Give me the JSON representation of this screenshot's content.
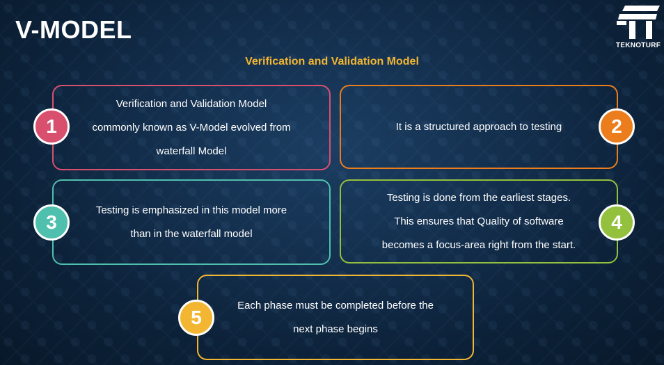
{
  "header": {
    "title": "V-MODEL",
    "subtitle": "Verification and Validation Model"
  },
  "logo": {
    "text": "TEKNOTURF"
  },
  "cards": [
    {
      "number": "1",
      "text": "Verification and Validation Model\ncommonly known as V-Model evolved from\nwaterfall Model",
      "color": "#d9506f"
    },
    {
      "number": "2",
      "text": "It is a structured approach to testing",
      "color": "#ec7d1c"
    },
    {
      "number": "3",
      "text": "Testing is emphasized in this model more\nthan in the waterfall model",
      "color": "#4fbfae"
    },
    {
      "number": "4",
      "text": "Testing is done from the earliest stages.\nThis ensures that Quality of software\nbecomes a focus-area right from the start.",
      "color": "#93c13e"
    },
    {
      "number": "5",
      "text": "Each phase must be completed before the\nnext phase begins",
      "color": "#f2b632"
    }
  ]
}
